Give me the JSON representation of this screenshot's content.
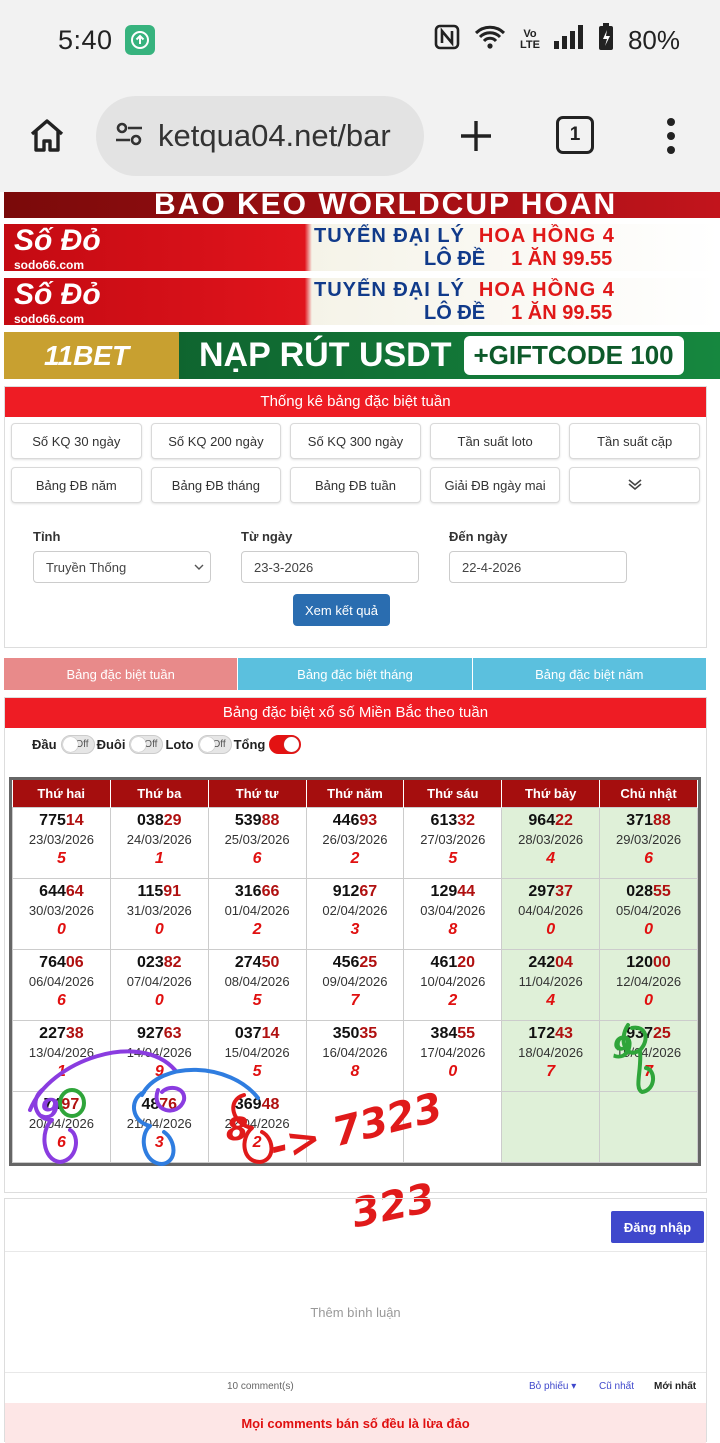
{
  "status": {
    "time": "5:40",
    "battery": "80%"
  },
  "browser": {
    "url": "ketqua04.net/bar",
    "tab_count": "1"
  },
  "banners": {
    "top_text": "BÁO KÈO WORLDCUP   HOÀN",
    "sodo": {
      "brand": "Số Đỏ",
      "sub": "sodo66.com",
      "line1a": "TUYỂN ĐẠI LÝ",
      "line1b": "HOA HỒNG 4",
      "line2a": "LÔ ĐỀ",
      "line2b": "1 ĂN 99.55"
    },
    "bet": {
      "brand": "11BET",
      "tagline": "NẠP RÚT USDT",
      "gift": "+GIFTCODE 100"
    }
  },
  "stats_panel": {
    "title": "Thống kê bảng đặc biệt tuần",
    "buttons": [
      "Số KQ 30 ngày",
      "Số KQ 200 ngày",
      "Số KQ 300 ngày",
      "Tần suất loto",
      "Tần suất cặp",
      "Bảng ĐB năm",
      "Bảng ĐB tháng",
      "Bảng ĐB tuần",
      "Giải ĐB ngày mai",
      ""
    ],
    "tinh_label": "Tỉnh",
    "tinh_value": "Truyền Thống",
    "tu_ngay_label": "Từ ngày",
    "tu_ngay_value": "23-3-2026",
    "den_ngay_label": "Đến ngày",
    "den_ngay_value": "22-4-2026",
    "submit": "Xem kết quả"
  },
  "tabs": [
    {
      "label": "Bảng đặc biệt tuần",
      "color": "#e88a8a"
    },
    {
      "label": "Bảng đặc biệt tháng",
      "color": "#5bc0de"
    },
    {
      "label": "Bảng đặc biệt năm",
      "color": "#5bc0de"
    }
  ],
  "table_panel": {
    "title": "Bảng đặc biệt xổ số Miền Bắc theo tuần",
    "toggles": [
      {
        "label": "Đầu",
        "state": "Off"
      },
      {
        "label": "Đuôi",
        "state": "Off"
      },
      {
        "label": "Loto",
        "state": "Off"
      },
      {
        "label": "Tổng",
        "state": "On"
      }
    ],
    "headers": [
      "Thứ hai",
      "Thứ ba",
      "Thứ tư",
      "Thứ năm",
      "Thứ sáu",
      "Thứ bảy",
      "Chủ nhật"
    ],
    "rows": [
      [
        [
          "775",
          "14",
          "23/03/2026",
          "5"
        ],
        [
          "038",
          "29",
          "24/03/2026",
          "1"
        ],
        [
          "539",
          "88",
          "25/03/2026",
          "6"
        ],
        [
          "446",
          "93",
          "26/03/2026",
          "2"
        ],
        [
          "613",
          "32",
          "27/03/2026",
          "5"
        ],
        [
          "964",
          "22",
          "28/03/2026",
          "4"
        ],
        [
          "371",
          "88",
          "29/03/2026",
          "6"
        ]
      ],
      [
        [
          "644",
          "64",
          "30/03/2026",
          "0"
        ],
        [
          "115",
          "91",
          "31/03/2026",
          "0"
        ],
        [
          "316",
          "66",
          "01/04/2026",
          "2"
        ],
        [
          "912",
          "67",
          "02/04/2026",
          "3"
        ],
        [
          "129",
          "44",
          "03/04/2026",
          "8"
        ],
        [
          "297",
          "37",
          "04/04/2026",
          "0"
        ],
        [
          "028",
          "55",
          "05/04/2026",
          "0"
        ]
      ],
      [
        [
          "764",
          "06",
          "06/04/2026",
          "6"
        ],
        [
          "023",
          "82",
          "07/04/2026",
          "0"
        ],
        [
          "274",
          "50",
          "08/04/2026",
          "5"
        ],
        [
          "456",
          "25",
          "09/04/2026",
          "7"
        ],
        [
          "461",
          "20",
          "10/04/2026",
          "2"
        ],
        [
          "242",
          "04",
          "11/04/2026",
          "4"
        ],
        [
          "120",
          "00",
          "12/04/2026",
          "0"
        ]
      ],
      [
        [
          "227",
          "38",
          "13/04/2026",
          "1"
        ],
        [
          "927",
          "63",
          "14/04/2026",
          "9"
        ],
        [
          "037",
          "14",
          "15/04/2026",
          "5"
        ],
        [
          "350",
          "35",
          "16/04/2026",
          "8"
        ],
        [
          "384",
          "55",
          "17/04/2026",
          "0"
        ],
        [
          "172",
          "43",
          "18/04/2026",
          "7"
        ],
        [
          "937",
          "25",
          "19/04/2026",
          "7"
        ]
      ],
      [
        [
          "74",
          "97",
          "20/04/2026",
          "6"
        ],
        [
          "48",
          "76",
          "21/04/2026",
          "3"
        ],
        [
          "369",
          "48",
          "22/04/2026",
          "2"
        ],
        null,
        null,
        null,
        null
      ]
    ]
  },
  "handwriting": [
    "-> 7323",
    "323",
    "9",
    "8",
    "9"
  ],
  "comments": {
    "login": "Đăng nhập",
    "placeholder": "Thêm bình luận",
    "count": "10 comment(s)",
    "sort_vote": "Bỏ phiếu",
    "sort_old": "Cũ nhất",
    "sort_new": "Mới nhất",
    "warning": "Mọi comments bán số đều là lừa đảo"
  }
}
